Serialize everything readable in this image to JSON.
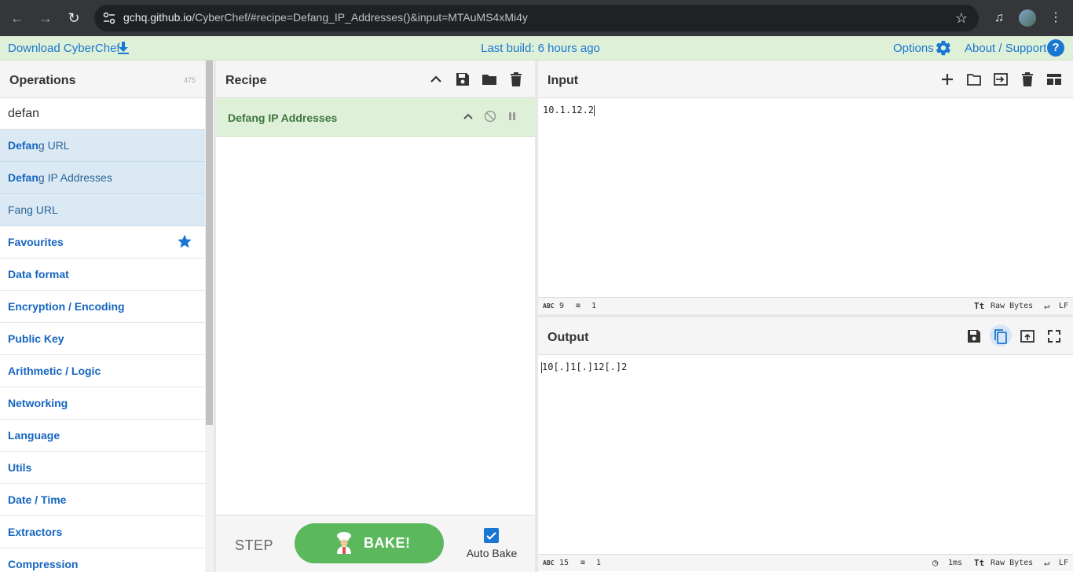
{
  "browser": {
    "url_host": "gchq.github.io",
    "url_path": "/CyberChef/#recipe=Defang_IP_Addresses()&input=MTAuMS4xMi4y"
  },
  "banner": {
    "download": "Download CyberChef",
    "build": "Last build: 6 hours ago",
    "options": "Options",
    "about": "About / Support",
    "help": "?"
  },
  "operations": {
    "title": "Operations",
    "count": "475",
    "search_value": "defan",
    "results": [
      {
        "match": "Defan",
        "rest": "g URL"
      },
      {
        "match": "Defan",
        "rest": "g IP Addresses"
      },
      {
        "match": "",
        "rest": "Fang URL"
      }
    ],
    "categories": [
      "Favourites",
      "Data format",
      "Encryption / Encoding",
      "Public Key",
      "Arithmetic / Logic",
      "Networking",
      "Language",
      "Utils",
      "Date / Time",
      "Extractors",
      "Compression"
    ]
  },
  "recipe": {
    "title": "Recipe",
    "operation": "Defang IP Addresses",
    "step": "STEP",
    "bake": "BAKE!",
    "auto_bake": "Auto Bake"
  },
  "input": {
    "title": "Input",
    "value": "10.1.12.2",
    "chars": "9",
    "lines": "1",
    "encoding": "Raw Bytes",
    "eol": "LF"
  },
  "output": {
    "title": "Output",
    "value": "10[.]1[.]12[.]2",
    "chars": "15",
    "lines": "1",
    "time": "1ms",
    "encoding": "Raw Bytes",
    "eol": "LF"
  },
  "colors": {
    "accent": "#1976d2",
    "banner_bg": "#dff0d8",
    "bake_green": "#5cb85c",
    "search_result_bg": "#dbe9f4"
  }
}
